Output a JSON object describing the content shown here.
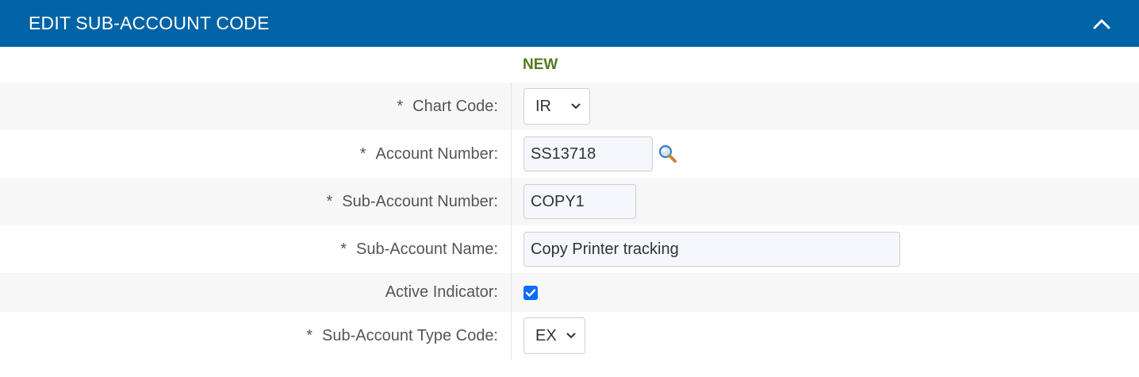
{
  "header": {
    "title": "EDIT SUB-ACCOUNT CODE",
    "collapse_icon": "chevron-up-icon"
  },
  "status": "NEW",
  "required_marker": "*",
  "fields": {
    "chart_code": {
      "label": "Chart Code:",
      "value": "IR"
    },
    "account_number": {
      "label": "Account Number:",
      "value": "SS13718",
      "lookup_icon": "magnifier-icon"
    },
    "sub_account_number": {
      "label": "Sub-Account Number:",
      "value": "COPY1"
    },
    "sub_account_name": {
      "label": "Sub-Account Name:",
      "value": "Copy Printer tracking"
    },
    "active_indicator": {
      "label": "Active Indicator:",
      "checked": true
    },
    "sub_account_type_code": {
      "label": "Sub-Account Type Code:",
      "value": "EX"
    }
  },
  "colors": {
    "header_bg": "#0063a6",
    "status_text": "#527c1e",
    "row_shade": "#f7f7f7",
    "checkbox": "#0b6cff"
  }
}
